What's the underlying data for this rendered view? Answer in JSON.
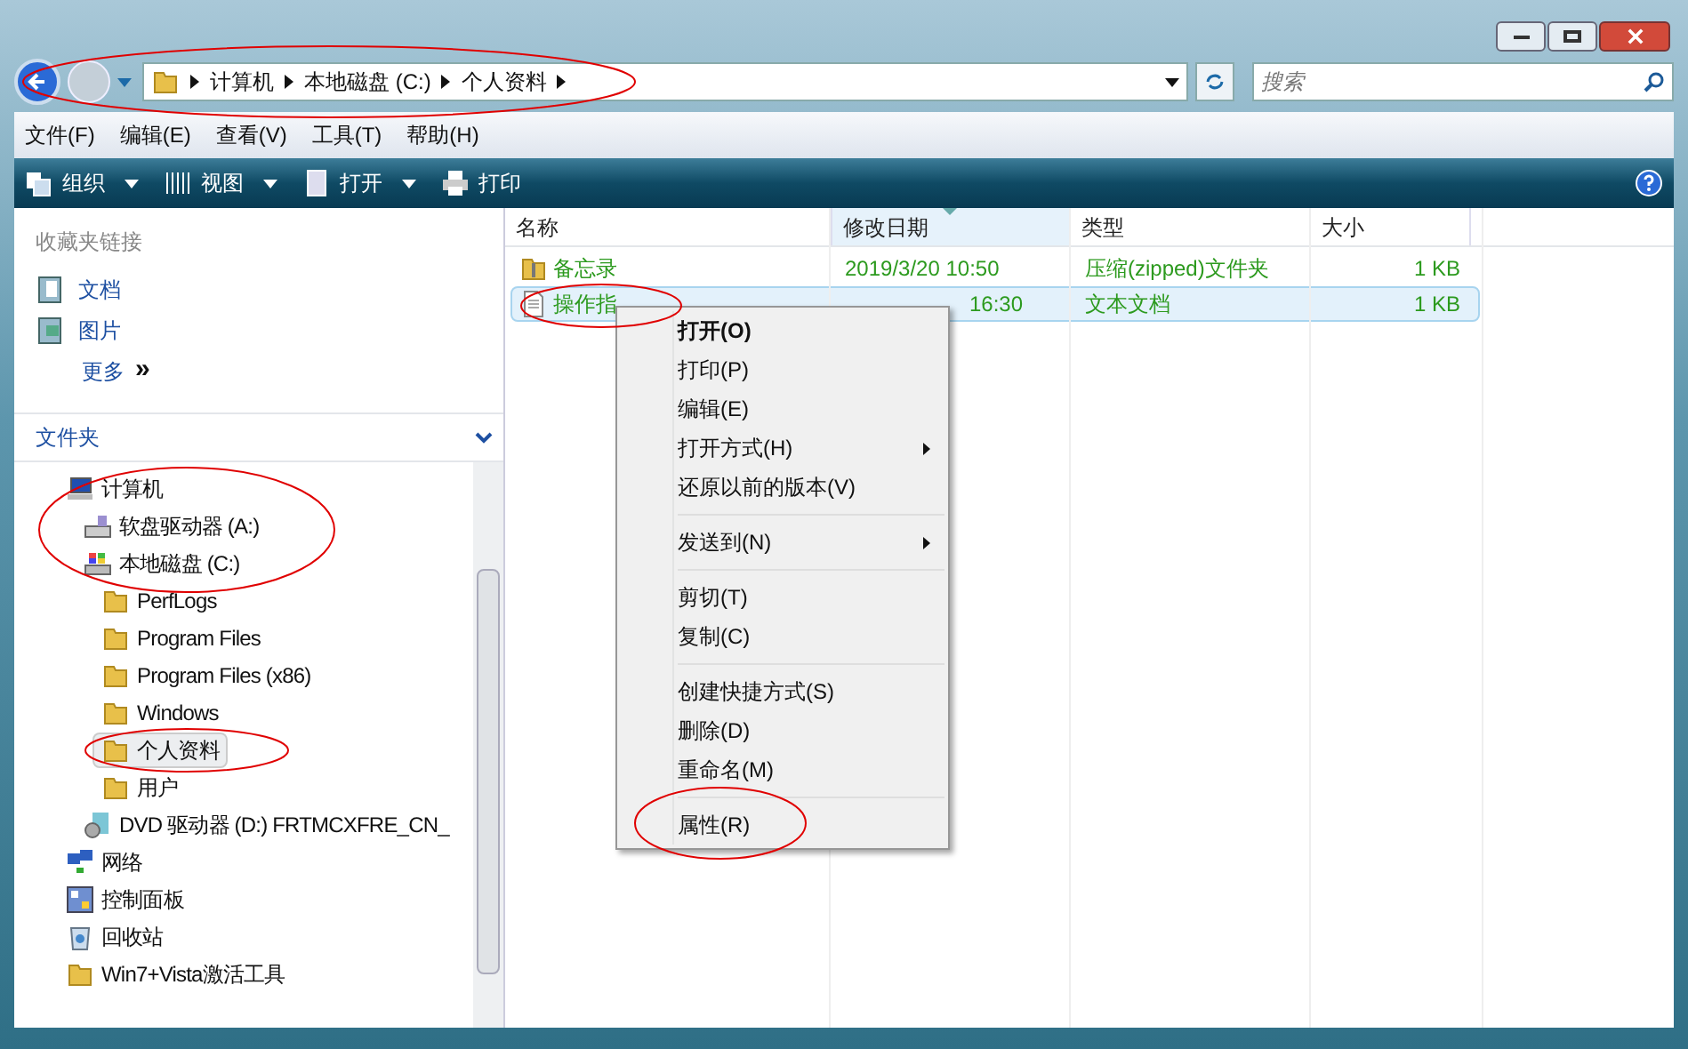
{
  "address_bar": {
    "crumbs": [
      "计算机",
      "本地磁盘 (C:)",
      "个人资料"
    ]
  },
  "search": {
    "placeholder": "搜索"
  },
  "menu_bar": [
    "文件(F)",
    "编辑(E)",
    "查看(V)",
    "工具(T)",
    "帮助(H)"
  ],
  "toolbar": [
    {
      "label": "组织",
      "kind": "organize",
      "dropdown": true
    },
    {
      "label": "视图",
      "kind": "views",
      "dropdown": true
    },
    {
      "label": "打开",
      "kind": "open",
      "dropdown": true
    },
    {
      "label": "打印",
      "kind": "print",
      "dropdown": false
    }
  ],
  "favorites": {
    "title": "收藏夹链接",
    "items": [
      {
        "label": "文档",
        "kind": "documents"
      },
      {
        "label": "图片",
        "kind": "pictures"
      }
    ],
    "more": "更多",
    "more_glyph": "»"
  },
  "folders": {
    "title": "文件夹",
    "tree": [
      {
        "label": "计算机",
        "kind": "computer",
        "selected": false,
        "children": [
          {
            "label": "软盘驱动器 (A:)",
            "kind": "floppy",
            "selected": false
          },
          {
            "label": "本地磁盘 (C:)",
            "kind": "disk",
            "selected": false,
            "children": [
              {
                "label": "PerfLogs",
                "kind": "folder",
                "selected": false
              },
              {
                "label": "Program Files",
                "kind": "folder",
                "selected": false
              },
              {
                "label": "Program Files (x86)",
                "kind": "folder",
                "selected": false
              },
              {
                "label": "Windows",
                "kind": "folder",
                "selected": false
              },
              {
                "label": "个人资料",
                "kind": "folder",
                "selected": true
              },
              {
                "label": "用户",
                "kind": "folder",
                "selected": false
              }
            ]
          },
          {
            "label": "DVD 驱动器 (D:) FRTMCXFRE_CN_",
            "kind": "dvd",
            "selected": false
          }
        ]
      },
      {
        "label": "网络",
        "kind": "network",
        "selected": false
      },
      {
        "label": "控制面板",
        "kind": "control",
        "selected": false
      },
      {
        "label": "回收站",
        "kind": "recycle",
        "selected": false
      },
      {
        "label": "Win7+Vista激活工具",
        "kind": "folder",
        "selected": false
      }
    ]
  },
  "table": {
    "columns": [
      {
        "label": "名称",
        "sorted": false
      },
      {
        "label": "修改日期",
        "sorted": true
      },
      {
        "label": "类型",
        "sorted": false
      },
      {
        "label": "大小",
        "sorted": false
      }
    ],
    "rows": [
      {
        "kind": "zip",
        "selected": false,
        "cells": [
          "备忘录",
          "2019/3/20 10:50",
          "压缩(zipped)文件夹",
          "1 KB"
        ]
      },
      {
        "kind": "text",
        "selected": true,
        "cells": [
          "操作指",
          "16:30",
          "文本文档",
          "1 KB"
        ]
      }
    ]
  },
  "context_menu": {
    "groups": [
      [
        {
          "label": "打开(O)",
          "default": true,
          "submenu": false
        },
        {
          "label": "打印(P)",
          "default": false,
          "submenu": false
        },
        {
          "label": "编辑(E)",
          "default": false,
          "submenu": false
        },
        {
          "label": "打开方式(H)",
          "default": false,
          "submenu": true
        },
        {
          "label": "还原以前的版本(V)",
          "default": false,
          "submenu": false
        }
      ],
      [
        {
          "label": "发送到(N)",
          "default": false,
          "submenu": true
        }
      ],
      [
        {
          "label": "剪切(T)",
          "default": false,
          "submenu": false
        },
        {
          "label": "复制(C)",
          "default": false,
          "submenu": false
        }
      ],
      [
        {
          "label": "创建快捷方式(S)",
          "default": false,
          "submenu": false
        },
        {
          "label": "删除(D)",
          "default": false,
          "submenu": false
        },
        {
          "label": "重命名(M)",
          "default": false,
          "submenu": false
        }
      ],
      [
        {
          "label": "属性(R)",
          "default": false,
          "submenu": false
        }
      ]
    ]
  },
  "annotations": [
    {
      "kind": "ellipse"
    },
    {
      "kind": "ellipse"
    },
    {
      "kind": "ellipse"
    },
    {
      "kind": "ellipse"
    },
    {
      "kind": "ellipse"
    }
  ]
}
